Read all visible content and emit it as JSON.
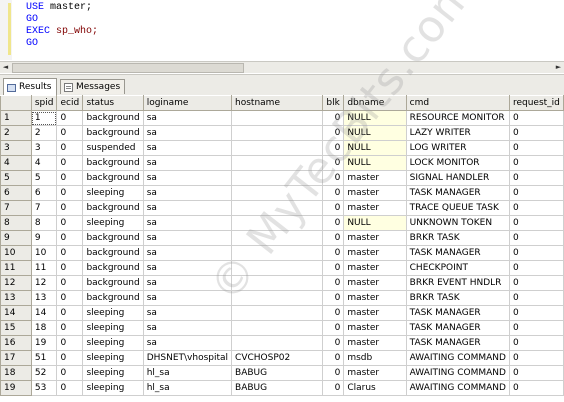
{
  "editor": {
    "lines": [
      {
        "kw": "USE ",
        "rest": "master;"
      },
      {
        "kw": "GO",
        "rest": ""
      },
      {
        "kw": "EXEC ",
        "rest": "sp_who;",
        "rest_class": "sp"
      },
      {
        "kw": "GO",
        "rest": ""
      }
    ]
  },
  "scrollbar": {
    "left_arrow": "◄",
    "right_arrow": "►"
  },
  "tabs": [
    {
      "label": "Results",
      "active": true
    },
    {
      "label": "Messages",
      "active": false
    }
  ],
  "columns": [
    "",
    "spid",
    "ecid",
    "status",
    "loginame",
    "hostname",
    "blk",
    "dbname",
    "cmd",
    "request_id"
  ],
  "rows": [
    [
      "1",
      "1",
      "0",
      "background",
      "sa",
      "",
      "0",
      "NULL",
      "RESOURCE MONITOR",
      "0"
    ],
    [
      "2",
      "2",
      "0",
      "background",
      "sa",
      "",
      "0",
      "NULL",
      "LAZY WRITER",
      "0"
    ],
    [
      "3",
      "3",
      "0",
      "suspended",
      "sa",
      "",
      "0",
      "NULL",
      "LOG WRITER",
      "0"
    ],
    [
      "4",
      "4",
      "0",
      "background",
      "sa",
      "",
      "0",
      "NULL",
      "LOCK MONITOR",
      "0"
    ],
    [
      "5",
      "5",
      "0",
      "background",
      "sa",
      "",
      "0",
      "master",
      "SIGNAL HANDLER",
      "0"
    ],
    [
      "6",
      "6",
      "0",
      "sleeping",
      "sa",
      "",
      "0",
      "master",
      "TASK MANAGER",
      "0"
    ],
    [
      "7",
      "7",
      "0",
      "background",
      "sa",
      "",
      "0",
      "master",
      "TRACE QUEUE TASK",
      "0"
    ],
    [
      "8",
      "8",
      "0",
      "sleeping",
      "sa",
      "",
      "0",
      "NULL",
      "UNKNOWN TOKEN",
      "0"
    ],
    [
      "9",
      "9",
      "0",
      "background",
      "sa",
      "",
      "0",
      "master",
      "BRKR TASK",
      "0"
    ],
    [
      "10",
      "10",
      "0",
      "background",
      "sa",
      "",
      "0",
      "master",
      "TASK MANAGER",
      "0"
    ],
    [
      "11",
      "11",
      "0",
      "background",
      "sa",
      "",
      "0",
      "master",
      "CHECKPOINT",
      "0"
    ],
    [
      "12",
      "12",
      "0",
      "background",
      "sa",
      "",
      "0",
      "master",
      "BRKR EVENT HNDLR",
      "0"
    ],
    [
      "13",
      "13",
      "0",
      "background",
      "sa",
      "",
      "0",
      "master",
      "BRKR TASK",
      "0"
    ],
    [
      "14",
      "14",
      "0",
      "sleeping",
      "sa",
      "",
      "0",
      "master",
      "TASK MANAGER",
      "0"
    ],
    [
      "15",
      "18",
      "0",
      "sleeping",
      "sa",
      "",
      "0",
      "master",
      "TASK MANAGER",
      "0"
    ],
    [
      "16",
      "19",
      "0",
      "sleeping",
      "sa",
      "",
      "0",
      "master",
      "TASK MANAGER",
      "0"
    ],
    [
      "17",
      "51",
      "0",
      "sleeping",
      "DHSNET\\vhospital",
      "CVCHOSP02",
      "0",
      "msdb",
      "AWAITING COMMAND",
      "0"
    ],
    [
      "18",
      "52",
      "0",
      "sleeping",
      "hl_sa",
      "BABUG",
      "0",
      "master",
      "AWAITING COMMAND",
      "0"
    ],
    [
      "19",
      "53",
      "0",
      "sleeping",
      "hl_sa",
      "BABUG",
      "0",
      "Clarus",
      "AWAITING COMMAND",
      "0"
    ]
  ],
  "watermark": "© MyTecBits.com",
  "colors": {
    "keyword": "#0000ff",
    "null_cell": "#ffffe1",
    "header_bg": "#ecebe6"
  }
}
